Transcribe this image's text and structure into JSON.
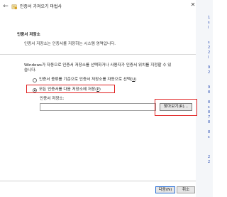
{
  "window": {
    "title": "인증서 가져오기 마법사"
  },
  "section": {
    "title": "인증서 저장소",
    "description": "인증서 저장소는 인증서를 저장하는 시스템 영역입니다."
  },
  "info": {
    "line1": "Windows가 자동으로 인증서 저장소를 선택하거나 사용자가 인증서 위치를 지정할 수 있",
    "line2": "습니다."
  },
  "options": [
    {
      "label": "인증서 종류를 기준으로 인증서 저장소를 자동으로 선택(",
      "key": "U",
      "selected": false
    },
    {
      "label": "모든 인증서를 다음 저장소에 저장(",
      "key": "P",
      "selected": true
    }
  ],
  "store": {
    "label": "인증서 저장소:",
    "value": "",
    "browse_label": "찾아보기(R)..."
  },
  "footer": {
    "next_label": "다음(N)",
    "cancel_label": "취소"
  },
  "right_edge_marks": "1\ns\nl\n\n\ns\n2\n2\nl\n\n9\n2\n\n\n9\n8\n\n8\ns\n8\n7\n8\n\n8\ns\n\n\n\n2\n2",
  "colors": {
    "highlight_border": "#e02020",
    "accent": "#2a6fd6"
  }
}
